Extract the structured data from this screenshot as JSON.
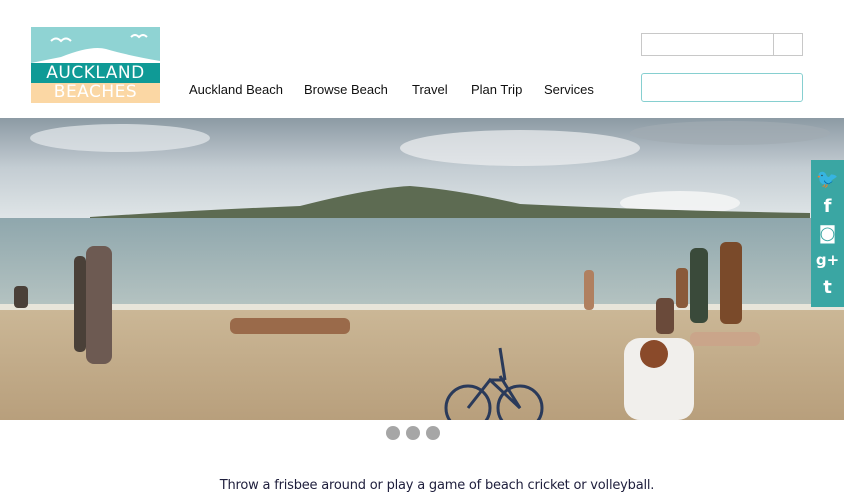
{
  "logo": {
    "line1": "AUCKLAND",
    "line2": "BEACHES"
  },
  "nav": {
    "items": [
      {
        "label": "Auckland Beach"
      },
      {
        "label": "Browse Beach"
      },
      {
        "label": "Travel"
      },
      {
        "label": "Plan Trip"
      },
      {
        "label": "Services"
      }
    ]
  },
  "search": {
    "value": "",
    "placeholder": ""
  },
  "secondary_input": {
    "value": "",
    "placeholder": ""
  },
  "social": {
    "icons": [
      "twitter-icon",
      "facebook-icon",
      "instagram-icon",
      "google-plus-icon",
      "tumblr-icon"
    ]
  },
  "slider": {
    "dot_count": 3
  },
  "caption": "Throw a frisbee around or play a game of beach cricket or volleyball.",
  "colors": {
    "teal": "#0f9a96",
    "light_teal": "#8fd3d3",
    "sand": "#fbd7a4",
    "social_bar": "#3aa6a3",
    "slider_dot": "#a6a6a6"
  }
}
